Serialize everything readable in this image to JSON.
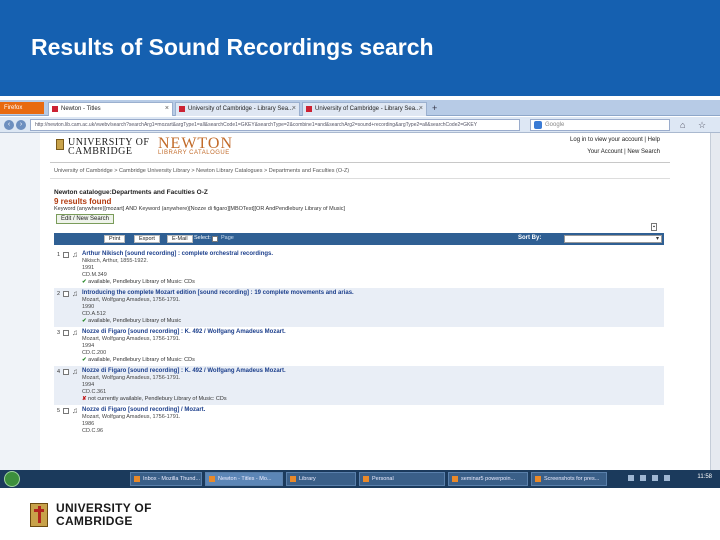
{
  "slide": {
    "title": "Results of Sound Recordings search",
    "footer_line1": "UNIVERSITY OF",
    "footer_line2": "CAMBRIDGE"
  },
  "browser": {
    "app_button": "Firefox",
    "tabs": [
      {
        "label": "Newton - Titles"
      },
      {
        "label": "University of Cambridge - Library Sea..."
      },
      {
        "label": "University of Cambridge - Library Sea..."
      }
    ],
    "new_tab": "+",
    "url": "http://newton.lib.cam.ac.uk/vwebv/search?searchArg1=mozart&argType1=all&searchCode1=GKEY&searchType=2&combine1=and&searchArg2=sound+recording&argType2=all&searchCode2=GKEY",
    "search_placeholder": "Google"
  },
  "site": {
    "uc_line1": "UNIVERSITY OF",
    "uc_line2": "CAMBRIDGE",
    "newton": "NEWTON",
    "newton_sub": "LIBRARY CATALOGUE",
    "login": "Log in to view your account | Help",
    "your_account": "Your Account | New Search",
    "breadcrumb": "University of Cambridge > Cambridge University Library > Newton Library Catalogues > Departments and Faculties (O-Z)",
    "headline": "Newton catalogue:Departments and Faculties O-Z",
    "count": "9 results found",
    "query": "Keyword (anywhere)[mozart] AND Keyword (anywhere)[Nozze di figaro][MBOTest][OR AndPendlebury Library of Music]",
    "edit_search": "Edit / New Search",
    "toolbar": {
      "print": "Print",
      "export": "Export",
      "email": "E-Mail",
      "select": "Select:",
      "page": "Page",
      "sort_by": "Sort By:"
    }
  },
  "results": [
    {
      "num": "1",
      "title": "Arthur Nikisch [sound recording] : complete orchestral recordings.",
      "lines": [
        "Nikisch, Arthur, 1855-1922.",
        "1991",
        "CD.M.349"
      ],
      "avail_status": "ok",
      "avail": "available, Pendlebury Library of Music: CDs"
    },
    {
      "num": "2",
      "title": "Introducing the complete Mozart edition [sound recording] : 19 complete movements and arias.",
      "lines": [
        "Mozart, Wolfgang Amadeus, 1756-1791.",
        "1990",
        "CD.A.512"
      ],
      "avail_status": "ok",
      "avail": "available, Pendlebury Library of Music"
    },
    {
      "num": "3",
      "title": "Nozze di Figaro [sound recording] : K. 492 / Wolfgang Amadeus Mozart.",
      "lines": [
        "Mozart, Wolfgang Amadeus, 1756-1791.",
        "1994",
        "CD.C.200"
      ],
      "avail_status": "ok",
      "avail": "available, Pendlebury Library of Music: CDs"
    },
    {
      "num": "4",
      "title": "Nozze di Figaro [sound recording] : K. 492 / Wolfgang Amadeus Mozart.",
      "lines": [
        "Mozart, Wolfgang Amadeus, 1756-1791.",
        "1994",
        "CD.C.361"
      ],
      "avail_status": "no",
      "avail": "not currently available, Pendlebury Library of Music: CDs"
    },
    {
      "num": "5",
      "title": "Nozze di Figaro [sound recording] / Mozart.",
      "lines": [
        "Mozart, Wolfgang Amadeus, 1756-1791.",
        "1986",
        "CD.C.96"
      ],
      "avail_status": "none",
      "avail": ""
    }
  ],
  "taskbar": {
    "items": [
      {
        "label": "Inbox - Mozilla Thund..."
      },
      {
        "label": "Newton - Titles - Mo..."
      },
      {
        "label": "Library"
      },
      {
        "label": "Personal"
      },
      {
        "label": "seminar5 powerpoin..."
      },
      {
        "label": "Screenshots for pres..."
      }
    ],
    "clock": "11:58"
  }
}
